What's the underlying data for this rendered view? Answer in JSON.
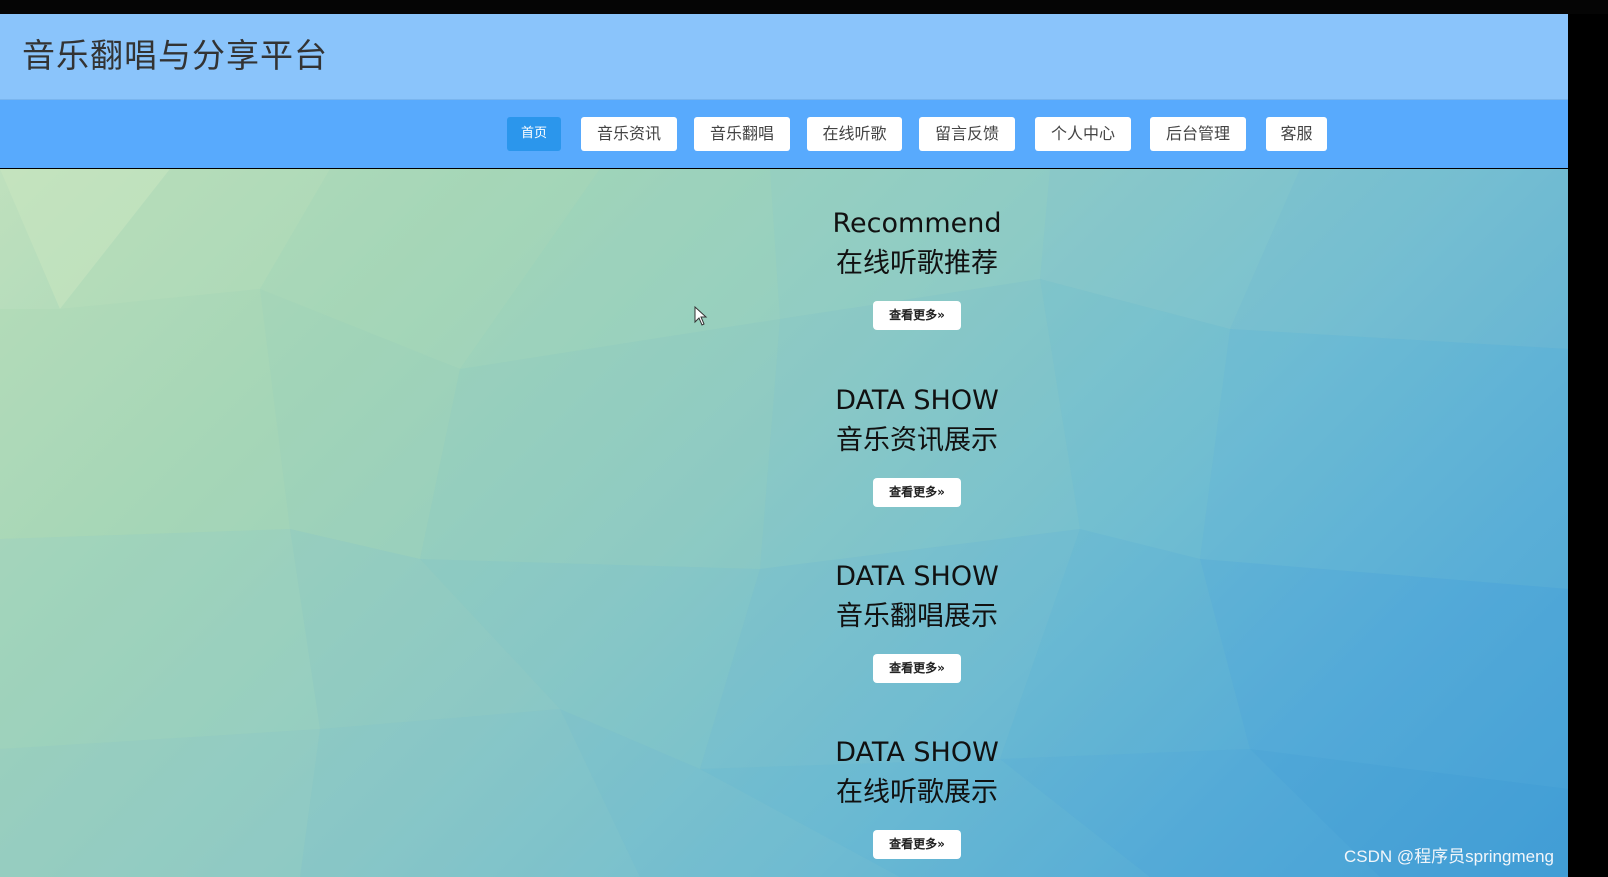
{
  "header": {
    "site_title": "音乐翻唱与分享平台"
  },
  "nav": {
    "items": [
      {
        "label": "首页",
        "active": true
      },
      {
        "label": "音乐资讯",
        "active": false
      },
      {
        "label": "音乐翻唱",
        "active": false
      },
      {
        "label": "在线听歌",
        "active": false
      },
      {
        "label": "留言反馈",
        "active": false
      },
      {
        "label": "个人中心",
        "active": false
      },
      {
        "label": "后台管理",
        "active": false
      },
      {
        "label": "客服",
        "active": false
      }
    ]
  },
  "sections": [
    {
      "title_en": "Recommend",
      "title_cn": "在线听歌推荐",
      "more_label": "查看更多»"
    },
    {
      "title_en": "DATA SHOW",
      "title_cn": "音乐资讯展示",
      "more_label": "查看更多»"
    },
    {
      "title_en": "DATA SHOW",
      "title_cn": "音乐翻唱展示",
      "more_label": "查看更多»"
    },
    {
      "title_en": "DATA SHOW",
      "title_cn": "在线听歌展示",
      "more_label": "查看更多»"
    }
  ],
  "watermark": "CSDN @程序员springmeng",
  "colors": {
    "header_bg": "#8ac4fb",
    "navbar_bg": "#58aafd",
    "active_nav_bg": "#2b96ec"
  }
}
